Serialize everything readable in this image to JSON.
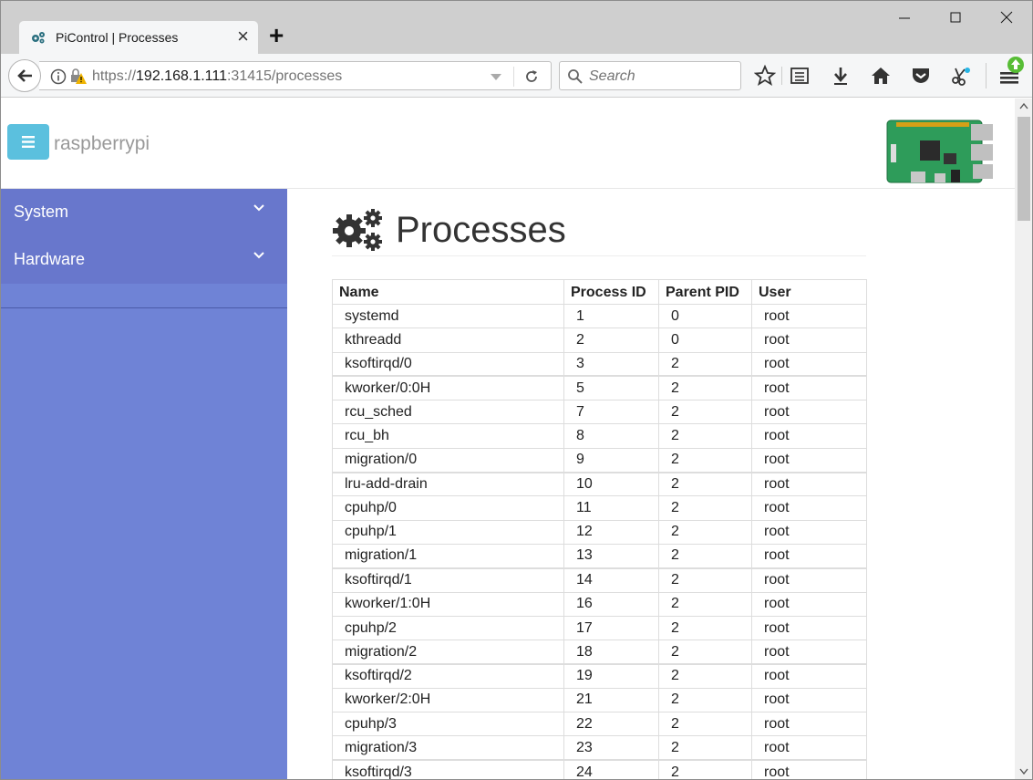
{
  "browser": {
    "tab_title": "PiControl | Processes",
    "url_scheme": "https://",
    "url_host": "192.168.1.111",
    "url_rest": ":31415/processes",
    "search_placeholder": "Search"
  },
  "header": {
    "brand": "raspberrypi",
    "menu_icon": "hamburger-icon",
    "accent": "#5bc0de"
  },
  "sidebar": {
    "items": [
      {
        "label": "System"
      },
      {
        "label": "Hardware"
      }
    ],
    "color": "#6f83d6"
  },
  "main": {
    "title": "Processes",
    "columns": [
      "Name",
      "Process ID",
      "Parent PID",
      "User"
    ],
    "rows": [
      [
        "systemd",
        "1",
        "0",
        "root"
      ],
      [
        "kthreadd",
        "2",
        "0",
        "root"
      ],
      [
        "ksoftirqd/0",
        "3",
        "2",
        "root"
      ],
      [
        "kworker/0:0H",
        "5",
        "2",
        "root"
      ],
      [
        "rcu_sched",
        "7",
        "2",
        "root"
      ],
      [
        "rcu_bh",
        "8",
        "2",
        "root"
      ],
      [
        "migration/0",
        "9",
        "2",
        "root"
      ],
      [
        "lru-add-drain",
        "10",
        "2",
        "root"
      ],
      [
        "cpuhp/0",
        "11",
        "2",
        "root"
      ],
      [
        "cpuhp/1",
        "12",
        "2",
        "root"
      ],
      [
        "migration/1",
        "13",
        "2",
        "root"
      ],
      [
        "ksoftirqd/1",
        "14",
        "2",
        "root"
      ],
      [
        "kworker/1:0H",
        "16",
        "2",
        "root"
      ],
      [
        "cpuhp/2",
        "17",
        "2",
        "root"
      ],
      [
        "migration/2",
        "18",
        "2",
        "root"
      ],
      [
        "ksoftirqd/2",
        "19",
        "2",
        "root"
      ],
      [
        "kworker/2:0H",
        "21",
        "2",
        "root"
      ],
      [
        "cpuhp/3",
        "22",
        "2",
        "root"
      ],
      [
        "migration/3",
        "23",
        "2",
        "root"
      ],
      [
        "ksoftirqd/3",
        "24",
        "2",
        "root"
      ]
    ]
  }
}
